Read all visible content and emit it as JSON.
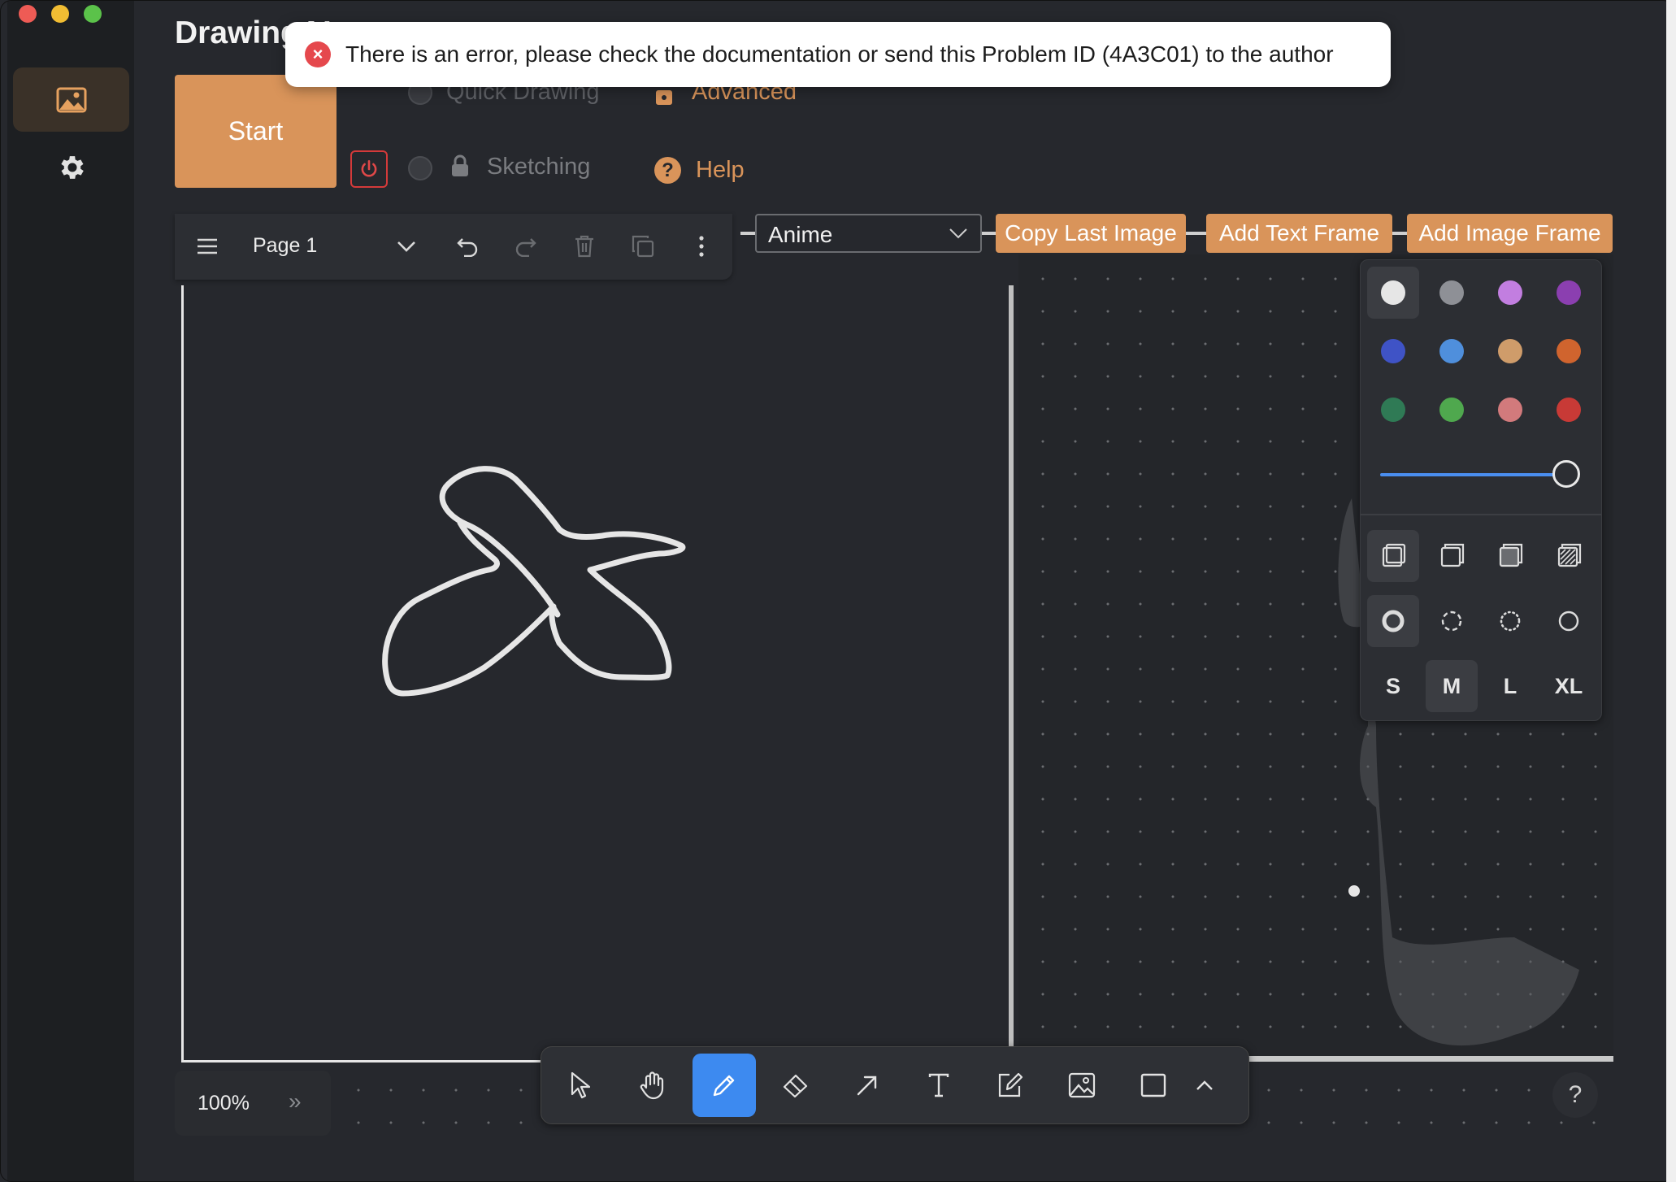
{
  "app": {
    "title": "DrawingAI"
  },
  "toast": {
    "message": "There is an error, please check the documentation or send this Problem ID (4A3C01) to the author"
  },
  "controls": {
    "start_label": "Start",
    "mode_quick_label": "Quick Drawing",
    "mode_sketch_label": "Sketching",
    "advanced_label": "Advanced",
    "help_label": "Help"
  },
  "page_toolbar": {
    "page_label": "Page 1"
  },
  "style_select": {
    "value": "Anime"
  },
  "action_buttons": {
    "copy_last_image": "Copy Last Image",
    "add_text_frame": "Add Text Frame",
    "add_image_frame": "Add Image Frame"
  },
  "style_panel": {
    "colors": [
      "#e6e6e6",
      "#8e9096",
      "#c27ee0",
      "#8b3fb0",
      "#3f53c6",
      "#4f8fdc",
      "#cf9c6a",
      "#d0642e",
      "#2f7a55",
      "#4fa84e",
      "#d27a7c",
      "#c83a36"
    ],
    "selected_color": "#e6e6e6",
    "sizes": [
      "S",
      "M",
      "L",
      "XL"
    ],
    "selected_size": "M"
  },
  "zoom": {
    "value": "100%",
    "expand_label": "»"
  },
  "help_round_label": "?"
}
